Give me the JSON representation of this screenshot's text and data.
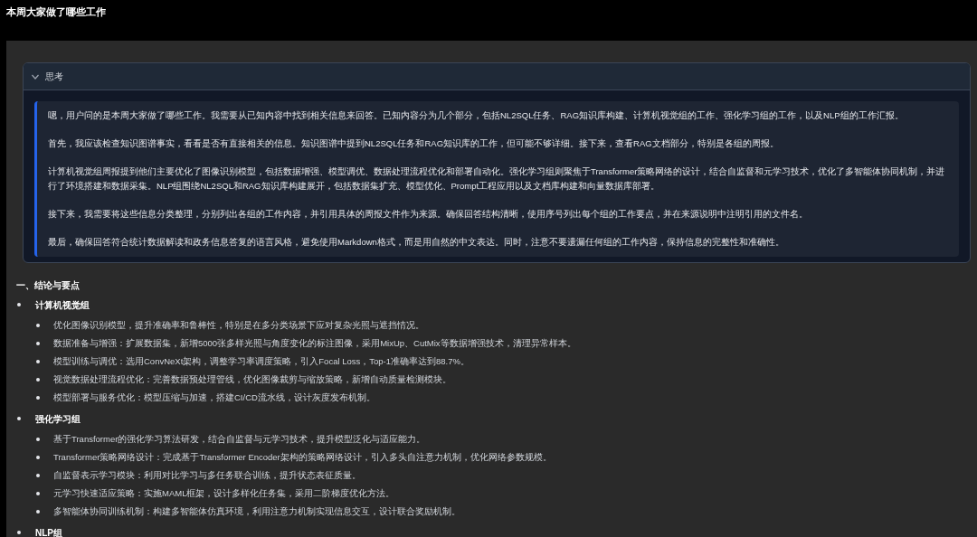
{
  "title": "本周大家做了哪些工作",
  "thinking": {
    "label": "思考",
    "expanded": true,
    "paragraphs": [
      "嗯，用户问的是本周大家做了哪些工作。我需要从已知内容中找到相关信息来回答。已知内容分为几个部分，包括NL2SQL任务、RAG知识库构建、计算机视觉组的工作、强化学习组的工作，以及NLP组的工作汇报。",
      "首先，我应该检查知识图谱事实，看看是否有直接相关的信息。知识图谱中提到NL2SQL任务和RAG知识库的工作，但可能不够详细。接下来，查看RAG文档部分，特别是各组的周报。",
      "计算机视觉组周报提到他们主要优化了图像识别模型，包括数据增强、模型调优、数据处理流程优化和部署自动化。强化学习组则聚焦于Transformer策略网络的设计，结合自监督和元学习技术，优化了多智能体协同机制，并进行了环境搭建和数据采集。NLP组围绕NL2SQL和RAG知识库构建展开，包括数据集扩充、模型优化、Prompt工程应用以及文档库构建和向量数据库部署。",
      "接下来，我需要将这些信息分类整理，分别列出各组的工作内容，并引用具体的周报文件作为来源。确保回答结构清晰，使用序号列出每个组的工作要点，并在来源说明中注明引用的文件名。",
      "最后，确保回答符合统计数据解读和政务信息答复的语言风格，避免使用Markdown格式，而是用自然的中文表达。同时，注意不要遗漏任何组的工作内容，保持信息的完整性和准确性。"
    ]
  },
  "answer": {
    "heading": "一、结论与要点",
    "groups": [
      {
        "name": "计算机视觉组",
        "items": [
          "优化图像识别模型，提升准确率和鲁棒性，特别是在多分类场景下应对复杂光照与遮挡情况。",
          "数据准备与增强：扩展数据集，新增5000张多样光照与角度变化的标注图像，采用MixUp、CutMix等数据增强技术，清理异常样本。",
          "模型训练与调优：选用ConvNeXt架构，调整学习率调度策略，引入Focal Loss，Top-1准确率达到88.7%。",
          "视觉数据处理流程优化：完善数据预处理管线，优化图像裁剪与缩放策略，新增自动质量检测模块。",
          "模型部署与服务优化：模型压缩与加速，搭建CI/CD流水线，设计灰度发布机制。"
        ]
      },
      {
        "name": "强化学习组",
        "items": [
          "基于Transformer的强化学习算法研发，结合自监督与元学习技术，提升模型泛化与适应能力。",
          "Transformer策略网络设计：完成基于Transformer Encoder架构的策略网络设计，引入多头自注意力机制，优化网络参数规模。",
          "自监督表示学习模块：利用对比学习与多任务联合训练，提升状态表征质量。",
          "元学习快速适应策略：实施MAML框架，设计多样化任务集，采用二阶梯度优化方法。",
          "多智能体协同训练机制：构建多智能体仿真环境，利用注意力机制实现信息交互，设计联合奖励机制。"
        ]
      },
      {
        "name": "NLP组"
      }
    ]
  }
}
